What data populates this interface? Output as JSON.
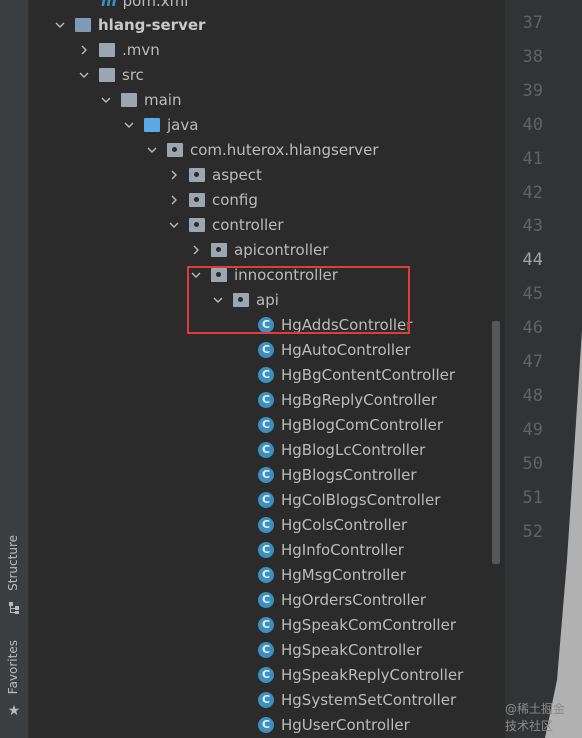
{
  "tool_strip": {
    "structure_label": "Structure",
    "favorites_label": "Favorites"
  },
  "tree": {
    "pom_file": "pom.xml",
    "module": "hlang-server",
    "mvn": ".mvn",
    "src": "src",
    "main": "main",
    "java": "java",
    "package": "com.huterox.hlangserver",
    "aspect": "aspect",
    "config": "config",
    "controller": "controller",
    "apicontroller": "apicontroller",
    "innocontroller": "innocontroller",
    "api": "api",
    "classes": [
      "HgAddsController",
      "HgAutoController",
      "HgBgContentController",
      "HgBgReplyController",
      "HgBlogComController",
      "HgBlogLcController",
      "HgBlogsController",
      "HgColBlogsController",
      "HgColsController",
      "HgInfoController",
      "HgMsgController",
      "HgOrdersController",
      "HgSpeakComController",
      "HgSpeakController",
      "HgSpeakReplyController",
      "HgSystemSetController",
      "HgUserController"
    ],
    "class_icon_letter": "C"
  },
  "gutter": {
    "line_numbers": [
      "37",
      "38",
      "39",
      "40",
      "41",
      "42",
      "43",
      "44",
      "45",
      "46",
      "47",
      "48",
      "49",
      "50",
      "51",
      "52"
    ],
    "current_line": "44"
  },
  "watermark": "@稀土掘金技术社区",
  "colors": {
    "highlight_box": "#e23b3b",
    "class_icon": "#3d8fbf",
    "background": "#2b2b2b"
  }
}
